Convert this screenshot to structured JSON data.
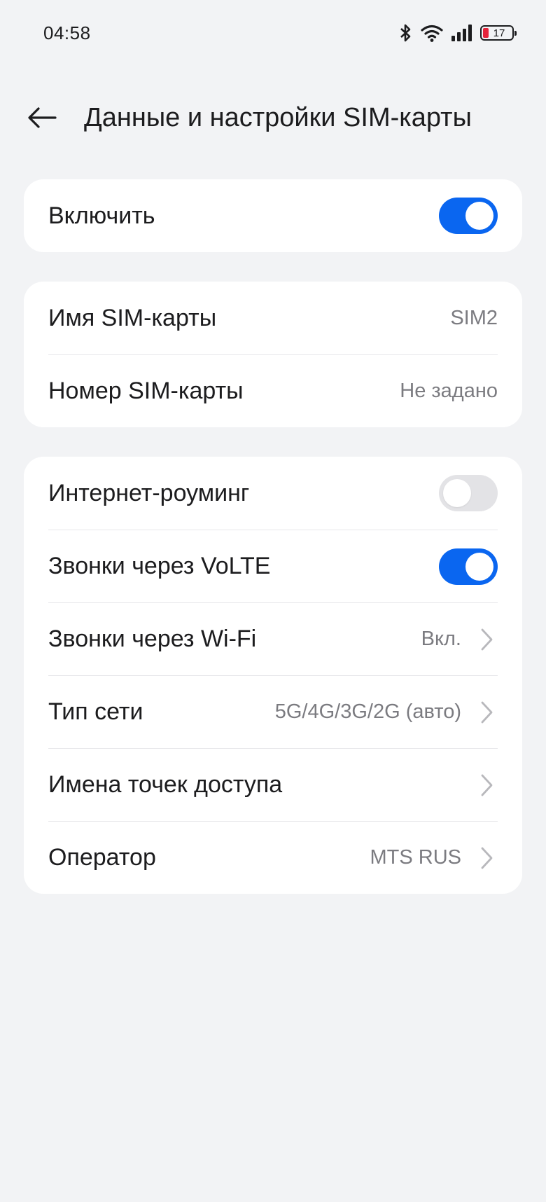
{
  "status_bar": {
    "time": "04:58",
    "battery_level": "17",
    "icons": [
      "bluetooth-icon",
      "wifi-icon",
      "signal-icon",
      "battery-icon"
    ]
  },
  "header": {
    "title": "Данные и настройки SIM-карты",
    "back_icon": "arrow-left-icon"
  },
  "enable_card": {
    "enable_label": "Включить",
    "enable_state": true
  },
  "sim_info": {
    "name_label": "Имя SIM-карты",
    "name_value": "SIM2",
    "number_label": "Номер SIM-карты",
    "number_value": "Не задано"
  },
  "network": {
    "roaming_label": "Интернет-роуминг",
    "roaming_state": false,
    "volte_label": "Звонки через VoLTE",
    "volte_state": true,
    "wifi_calls_label": "Звонки через Wi-Fi",
    "wifi_calls_value": "Вкл.",
    "network_type_label": "Тип сети",
    "network_type_value": "5G/4G/3G/2G (авто)",
    "apn_label": "Имена точек доступа",
    "operator_label": "Оператор",
    "operator_value": "MTS RUS"
  },
  "colors": {
    "accent": "#0a66f0",
    "background": "#f2f3f5",
    "card": "#ffffff",
    "battery_low": "#e5243b"
  }
}
